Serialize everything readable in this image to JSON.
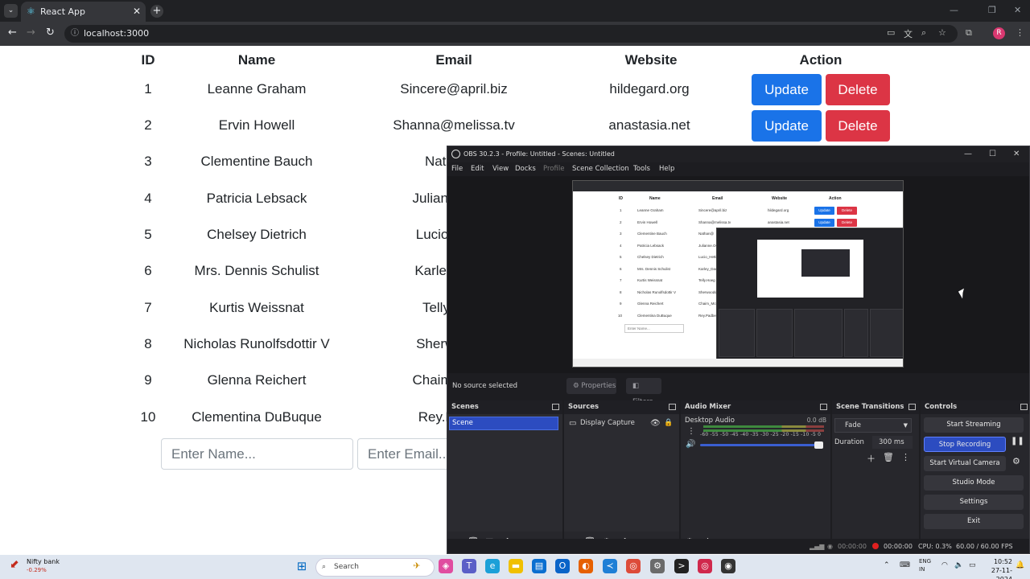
{
  "browser": {
    "tab_title": "React App",
    "url": "localhost:3000"
  },
  "table": {
    "headers": [
      "ID",
      "Name",
      "Email",
      "Website",
      "Action"
    ],
    "rows": [
      {
        "id": "1",
        "name": "Leanne Graham",
        "email": "Sincere@april.biz",
        "website": "hildegard.org"
      },
      {
        "id": "2",
        "name": "Ervin Howell",
        "email": "Shanna@melissa.tv",
        "website": "anastasia.net"
      },
      {
        "id": "3",
        "name": "Clementine Bauch",
        "email": "Nathan@",
        "website": ""
      },
      {
        "id": "4",
        "name": "Patricia Lebsack",
        "email": "Julianne.OCo",
        "website": ""
      },
      {
        "id": "5",
        "name": "Chelsey Dietrich",
        "email": "Lucio_Hettin",
        "website": ""
      },
      {
        "id": "6",
        "name": "Mrs. Dennis Schulist",
        "email": "Karley_Dach",
        "website": ""
      },
      {
        "id": "7",
        "name": "Kurtis Weissnat",
        "email": "Telly.Hoeg",
        "website": ""
      },
      {
        "id": "8",
        "name": "Nicholas Runolfsdottir V",
        "email": "Sherwood@",
        "website": ""
      },
      {
        "id": "9",
        "name": "Glenna Reichert",
        "email": "Chaim_McDe",
        "website": ""
      },
      {
        "id": "10",
        "name": "Clementina DuBuque",
        "email": "Rey.Padber",
        "website": ""
      }
    ],
    "update_label": "Update",
    "delete_label": "Delete",
    "name_placeholder": "Enter Name...",
    "email_placeholder": "Enter Email..."
  },
  "obs": {
    "title": "OBS 30.2.3 - Profile: Untitled - Scenes: Untitled",
    "menu": [
      "File",
      "Edit",
      "View",
      "Docks",
      "Profile",
      "Scene Collection",
      "Tools",
      "Help"
    ],
    "no_source": "No source selected",
    "properties": "Properties",
    "filters": "Filters",
    "scenes_title": "Scenes",
    "scene_item": "Scene",
    "sources_title": "Sources",
    "source_item": "Display Capture",
    "mixer_title": "Audio Mixer",
    "mixer_channel": "Desktop Audio",
    "mixer_db": "0.0 dB",
    "meter_scale": "-60 -55 -50 -45 -40 -35 -30 -25 -20 -15 -10 -5 0",
    "transitions_title": "Scene Transitions",
    "transition": "Fade",
    "duration_label": "Duration",
    "duration_value": "300 ms",
    "controls_title": "Controls",
    "controls": [
      "Start Streaming",
      "Stop Recording",
      "Start Virtual Camera",
      "Studio Mode",
      "Settings",
      "Exit"
    ],
    "status_stream_time": "00:00:00",
    "status_rec_time": "00:00:00",
    "status_cpu": "CPU: 0.3%",
    "status_fps": "60.00 / 60.00 FPS"
  },
  "taskbar": {
    "stock_name": "Nifty bank",
    "stock_change": "-0.29%",
    "search_placeholder": "Search",
    "lang_top": "ENG",
    "lang_bottom": "IN",
    "time": "10:52",
    "date": "27-11-2024"
  },
  "colors": {
    "update": "#1a73e8",
    "delete": "#dc3545",
    "obs_accent": "#2c4cc0",
    "rec": "#e02020"
  }
}
